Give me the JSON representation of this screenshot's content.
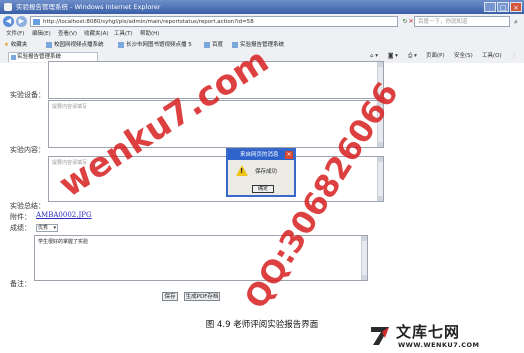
{
  "window": {
    "title": "实验报告管理系统 - Windows Internet Explorer",
    "minimize": "_",
    "maximize": "□",
    "close": "×"
  },
  "address_bar": {
    "url": "http://localhost:8080/syhgl/pls/admin/main/reportstatus/report.action?id=58",
    "search_placeholder": "百度一下，你就知道"
  },
  "menu": [
    "文件(F)",
    "编辑(E)",
    "查看(V)",
    "收藏夹(A)",
    "工具(T)",
    "帮助(H)"
  ],
  "favorites": {
    "label": "收藏夹",
    "items": [
      "校园网视频点播系统",
      "长沙市网图书馆视频点播 5",
      "百度",
      "实验报告管理系统"
    ]
  },
  "tab": {
    "label": "实验报告管理系统"
  },
  "toolbar_right": {
    "page": "页面(P)",
    "safety": "安全(S)",
    "tools": "工具(O)"
  },
  "form": {
    "equipment_label": "实验设备：",
    "equipment_placeholder": "",
    "content_label": "实验内容：",
    "content_placeholder": "提要内容请填写",
    "equipment_field_placeholder": "提要内容请填写",
    "summary_label": "实验总结：",
    "summary_placeholder": "提要内容请填写",
    "attachment_label": "附件：",
    "attachment_link": "AMBA0002.JPG",
    "grade_label": "成绩：",
    "grade_value": "优秀",
    "remarks_label": "备注：",
    "remarks_value": "学生很好的掌握了实验",
    "save_button": "保存",
    "pdf_button": "生成PDF存档"
  },
  "dialog": {
    "title": "来自网页的消息",
    "message": "保存成功",
    "ok": "确定"
  },
  "watermarks": [
    "wenku7.com",
    "QQ:306826066"
  ],
  "caption": "图 4.9  老师评阅实验报告界面",
  "logo": {
    "text": "文库七网",
    "url": "WWW.WENKU7.COM"
  }
}
